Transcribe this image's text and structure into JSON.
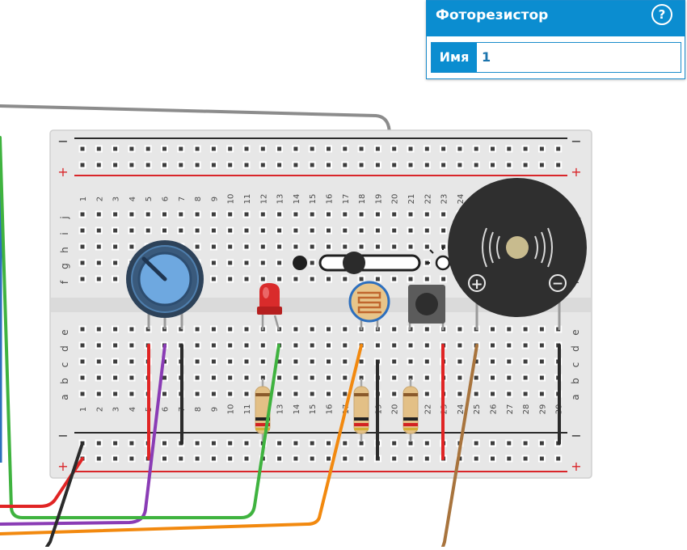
{
  "breadboard": {
    "column_numbers": [
      "1",
      "2",
      "3",
      "4",
      "5",
      "6",
      "7",
      "8",
      "9",
      "10",
      "11",
      "12",
      "13",
      "14",
      "15",
      "16",
      "17",
      "18",
      "19",
      "20",
      "21",
      "22",
      "23",
      "24",
      "25",
      "26",
      "27",
      "28",
      "29",
      "30"
    ],
    "row_letters_top": [
      "j",
      "i",
      "h",
      "g",
      "f"
    ],
    "row_letters_bottom": [
      "e",
      "d",
      "c",
      "b",
      "a"
    ],
    "rail_minus": "−",
    "rail_plus": "+"
  },
  "components": {
    "buzzer_plus": "+",
    "buzzer_minus": "−"
  },
  "colors": {
    "board": "#e7e7e7",
    "hole": "#3d3d3d",
    "rail_negative": "#2b2b2b",
    "rail_positive": "#d9262a",
    "wire_red": "#e02424",
    "wire_purple": "#8a3cb5",
    "wire_black": "#2b2b2b",
    "wire_green": "#3fb33f",
    "wire_orange": "#f2890f",
    "wire_brown": "#a8743d",
    "wire_gray": "#8c8c8c",
    "wire_blue": "#2c6fbd",
    "panel_accent": "#0b8dd0"
  },
  "panel": {
    "title": "Фоторезистор",
    "help": "?",
    "name_label": "Имя",
    "name_value": "1"
  }
}
